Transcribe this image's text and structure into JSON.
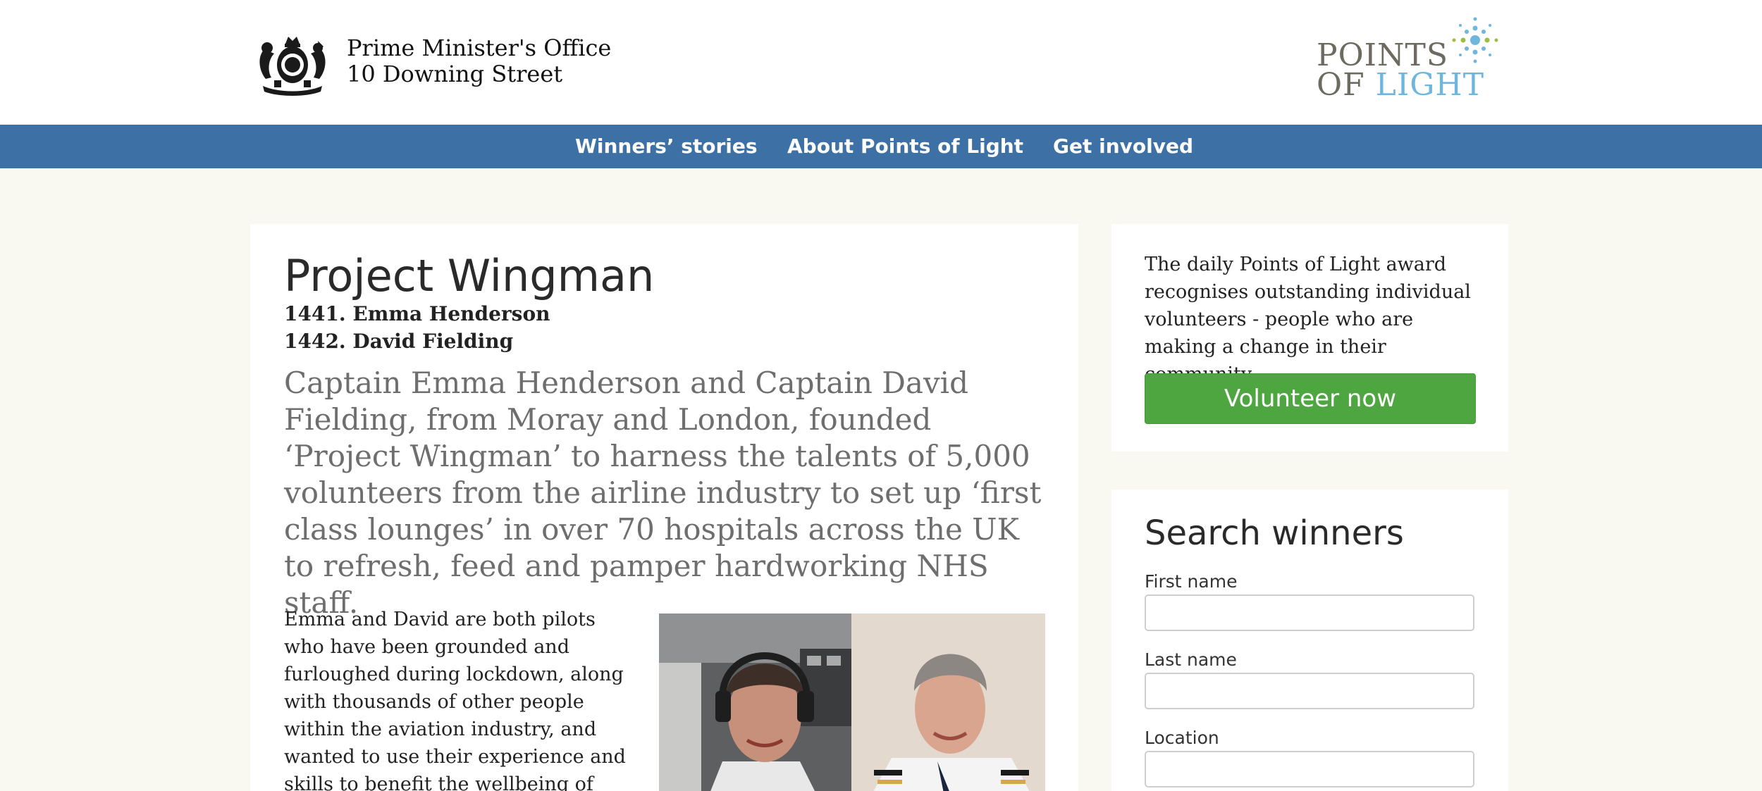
{
  "header": {
    "office_line1": "Prime Minister's Office",
    "office_line2": "10 Downing Street",
    "logo": {
      "line1": "POINTS",
      "line2_of": "OF",
      "line2_light": "LIGHT"
    }
  },
  "nav": {
    "items": [
      {
        "label": "Winners’ stories"
      },
      {
        "label": "About Points of Light"
      },
      {
        "label": "Get involved"
      }
    ]
  },
  "article": {
    "title": "Project Wingman",
    "winners": [
      "1441. Emma Henderson",
      "1442. David Fielding"
    ],
    "lead": "Captain Emma Henderson and Captain David Fielding, from Moray and London, founded ‘Project Wingman’ to harness the talents of 5,000 volunteers from the airline industry to set up ‘first class lounges’ in over 70 hospitals across the UK to refresh, feed and pamper hardworking NHS staff.",
    "body": "Emma and David are both pilots who have been grounded and furloughed during lockdown, along with thousands of other people within the aviation industry, and wanted to use their experience and skills to benefit the wellbeing of frontline NHS and"
  },
  "sidebar": {
    "award_text": "The daily Points of Light award recognises outstanding individual volunteers - people who are making a change in their community.",
    "volunteer_label": "Volunteer now",
    "search": {
      "title": "Search winners",
      "first_name_label": "First name",
      "last_name_label": "Last name",
      "location_label": "Location"
    }
  },
  "colors": {
    "nav_bg": "#3d71a6",
    "page_bg": "#f9f9f1",
    "button_green": "#4ea640",
    "logo_blue": "#6fb6de"
  }
}
